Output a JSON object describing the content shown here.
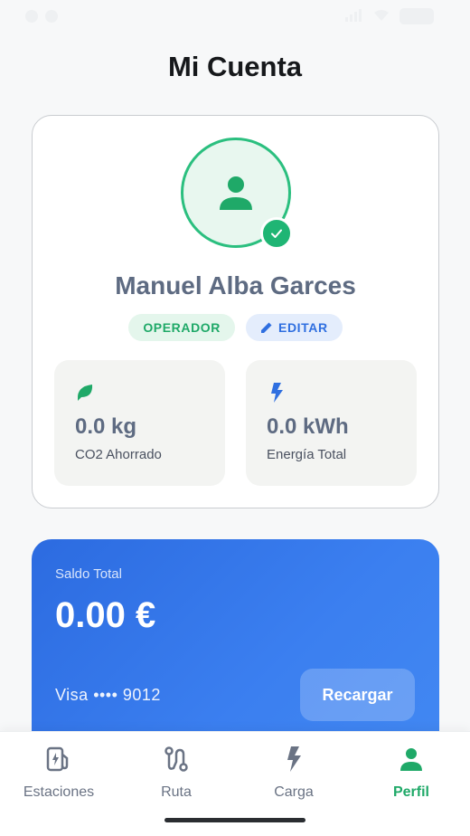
{
  "page": {
    "title": "Mi Cuenta"
  },
  "profile": {
    "name": "Manuel Alba Garces",
    "role_badge": "OPERADOR",
    "edit_badge": "EDITAR",
    "stats": [
      {
        "value": "0.0 kg",
        "label": "CO2 Ahorrado",
        "icon": "leaf-icon"
      },
      {
        "value": "0.0 kWh",
        "label": "Energía Total",
        "icon": "bolt-icon"
      }
    ]
  },
  "balance": {
    "label": "Saldo Total",
    "amount": "0.00 €",
    "card": "Visa •••• 9012",
    "recharge_label": "Recargar"
  },
  "nav": {
    "items": [
      {
        "label": "Estaciones",
        "icon": "ev-station-icon"
      },
      {
        "label": "Ruta",
        "icon": "route-icon"
      },
      {
        "label": "Carga",
        "icon": "bolt-icon"
      },
      {
        "label": "Perfil",
        "icon": "person-icon",
        "active": true
      }
    ]
  },
  "colors": {
    "accent_green": "#1fa968",
    "accent_blue": "#2f6fe0",
    "balance_gradient_start": "#2c6be0"
  }
}
